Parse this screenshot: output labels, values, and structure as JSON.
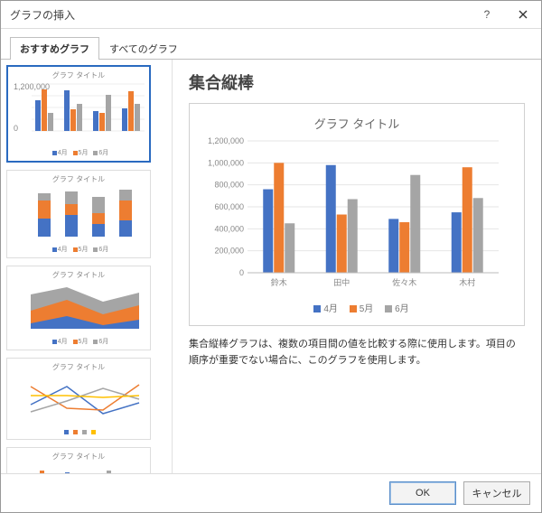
{
  "dialog": {
    "title": "グラフの挿入"
  },
  "tabs": {
    "recommended": "おすすめグラフ",
    "all": "すべてのグラフ"
  },
  "thumbs": {
    "title": "グラフ タイトル",
    "legend4": "4月",
    "legend5": "5月",
    "legend6": "6月"
  },
  "right": {
    "type_name": "集合縦棒",
    "chart_title": "グラフ タイトル",
    "description": "集合縦棒グラフは、複数の項目間の値を比較する際に使用します。項目の順序が重要でない場合に、このグラフを使用します。"
  },
  "buttons": {
    "ok": "OK",
    "cancel": "キャンセル"
  },
  "colors": {
    "s1": "#4472c4",
    "s2": "#ed7d31",
    "s3": "#a5a5a5"
  },
  "chart_data": {
    "type": "bar",
    "title": "グラフ タイトル",
    "categories": [
      "鈴木",
      "田中",
      "佐々木",
      "木村"
    ],
    "series": [
      {
        "name": "4月",
        "values": [
          760000,
          980000,
          490000,
          550000
        ]
      },
      {
        "name": "5月",
        "values": [
          1000000,
          530000,
          460000,
          960000
        ]
      },
      {
        "name": "6月",
        "values": [
          450000,
          670000,
          890000,
          680000
        ]
      }
    ],
    "ylabel": "",
    "xlabel": "",
    "ylim": [
      0,
      1200000
    ],
    "yticks": [
      0,
      200000,
      400000,
      600000,
      800000,
      1000000,
      1200000
    ]
  }
}
